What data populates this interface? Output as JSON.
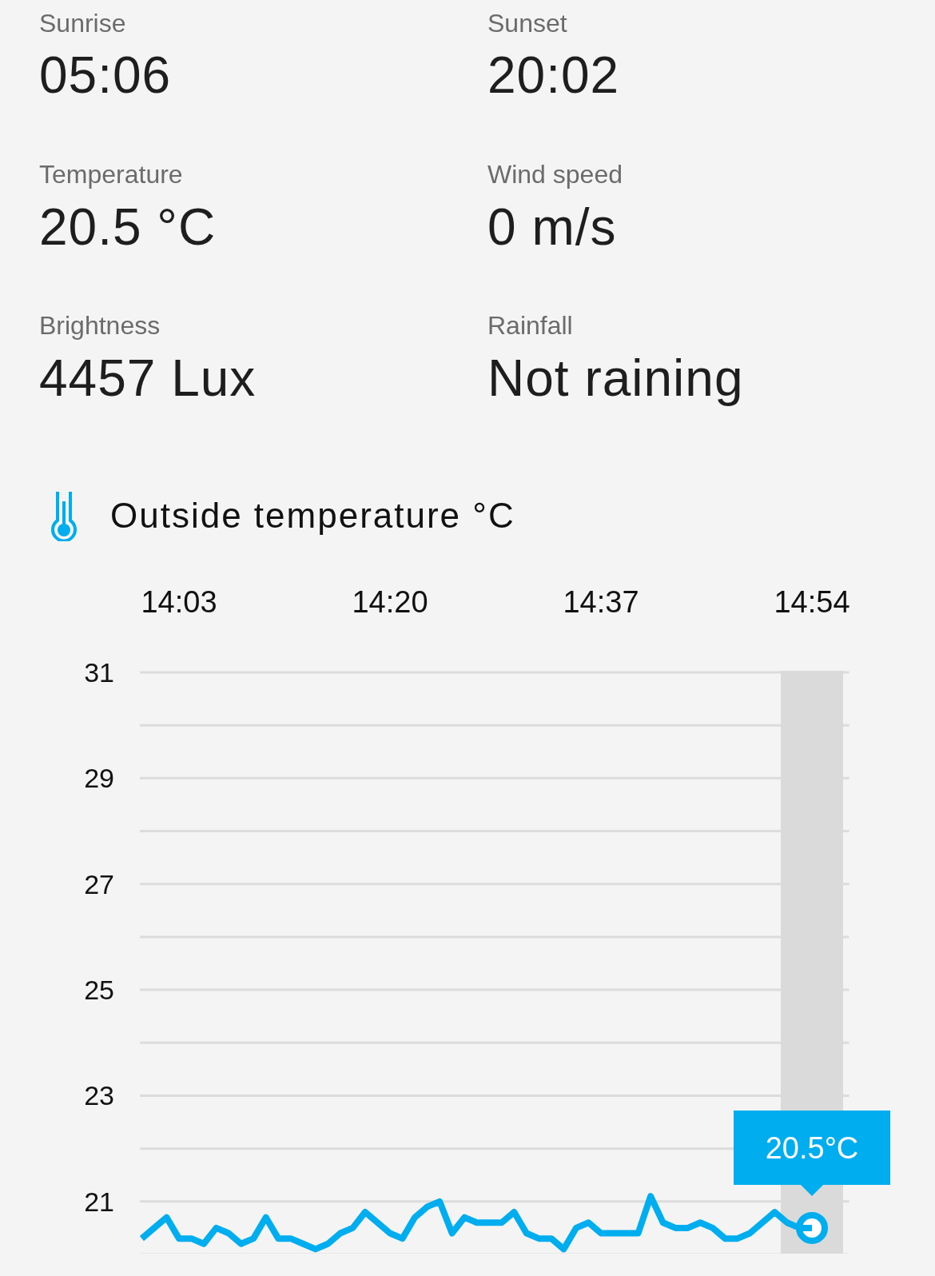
{
  "stats": [
    {
      "label": "Sunrise",
      "value": "05:06"
    },
    {
      "label": "Sunset",
      "value": "20:02"
    },
    {
      "label": "Temperature",
      "value": "20.5 °C"
    },
    {
      "label": "Wind speed",
      "value": "0 m/s"
    },
    {
      "label": "Brightness",
      "value": "4457 Lux"
    },
    {
      "label": "Rainfall",
      "value": "Not raining"
    }
  ],
  "chart": {
    "title": "Outside temperature °C",
    "chart_data": {
      "type": "line",
      "categories": [
        null,
        null,
        null,
        "14:03",
        null,
        null,
        null,
        null,
        null,
        null,
        null,
        null,
        null,
        null,
        null,
        null,
        null,
        null,
        null,
        null,
        "14:20",
        null,
        null,
        null,
        null,
        null,
        null,
        null,
        null,
        null,
        null,
        null,
        null,
        null,
        null,
        null,
        null,
        "14:37",
        null,
        null,
        null,
        null,
        null,
        null,
        null,
        null,
        null,
        null,
        null,
        null,
        null,
        null,
        null,
        null,
        "14:54"
      ],
      "series": [
        {
          "color": "#00aeef",
          "values": [
            20.3,
            20.5,
            20.7,
            20.3,
            20.3,
            20.2,
            20.5,
            20.4,
            20.2,
            20.3,
            20.7,
            20.3,
            20.3,
            20.2,
            20.1,
            20.2,
            20.4,
            20.5,
            20.8,
            20.6,
            20.4,
            20.3,
            20.7,
            20.9,
            21.0,
            20.4,
            20.7,
            20.6,
            20.6,
            20.6,
            20.8,
            20.4,
            20.3,
            20.3,
            20.1,
            20.5,
            20.6,
            20.4,
            20.4,
            20.4,
            20.4,
            21.1,
            20.6,
            20.5,
            20.5,
            20.6,
            20.5,
            20.3,
            20.3,
            20.4,
            20.6,
            20.8,
            20.6,
            20.5,
            20.5
          ]
        }
      ],
      "ylim": [
        20,
        31
      ],
      "grid": true,
      "yticks": [
        21,
        23,
        25,
        27,
        29,
        31
      ],
      "annotations": [
        "20.5°C"
      ]
    }
  }
}
